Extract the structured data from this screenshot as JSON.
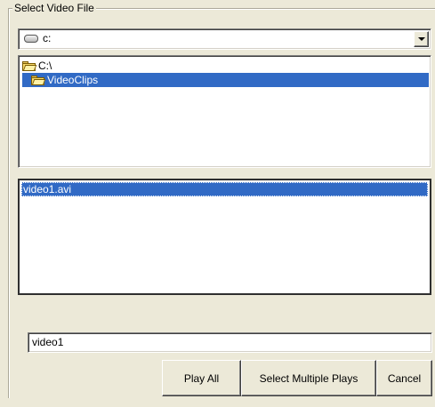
{
  "group": {
    "title": "Select Video File"
  },
  "drive": {
    "selected": "c:",
    "icon": "hard-drive-icon"
  },
  "directories": [
    {
      "label": "C:\\",
      "icon": "open-folder-icon",
      "selected": false
    },
    {
      "label": "VideoClips",
      "icon": "open-folder-icon",
      "selected": true
    }
  ],
  "files": [
    {
      "label": "video1.avi",
      "selected": true
    }
  ],
  "filename": {
    "value": "video1"
  },
  "buttons": {
    "play_all": "Play All",
    "select_multiple": "Select Multiple Plays",
    "cancel": "Cancel"
  },
  "colors": {
    "selection": "#316ac5",
    "face": "#ece9d8"
  }
}
